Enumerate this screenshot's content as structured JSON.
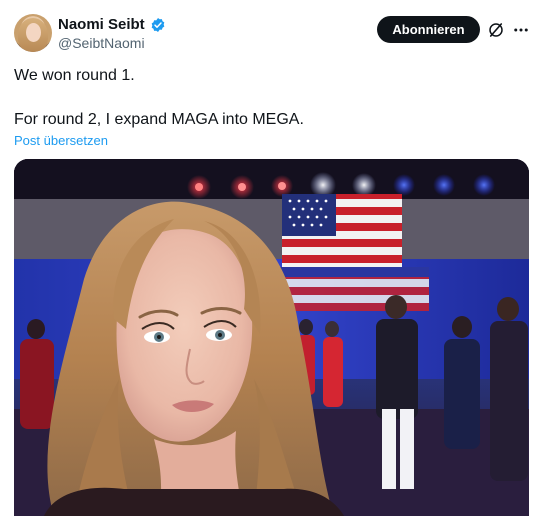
{
  "author": {
    "name": "Naomi Seibt",
    "handle": "@SeibtNaomi"
  },
  "actions": {
    "follow_label": "Abonnieren",
    "grok_icon": "grok-icon",
    "more_icon": "more-icon"
  },
  "tweet": {
    "line1": "We won round 1.",
    "line2": "For round 2, I expand MAGA into MEGA.",
    "translate_label": "Post übersetzen"
  },
  "colors": {
    "verified": "#1d9bf0",
    "link": "#1d9bf0",
    "button_bg": "#0f1419"
  }
}
